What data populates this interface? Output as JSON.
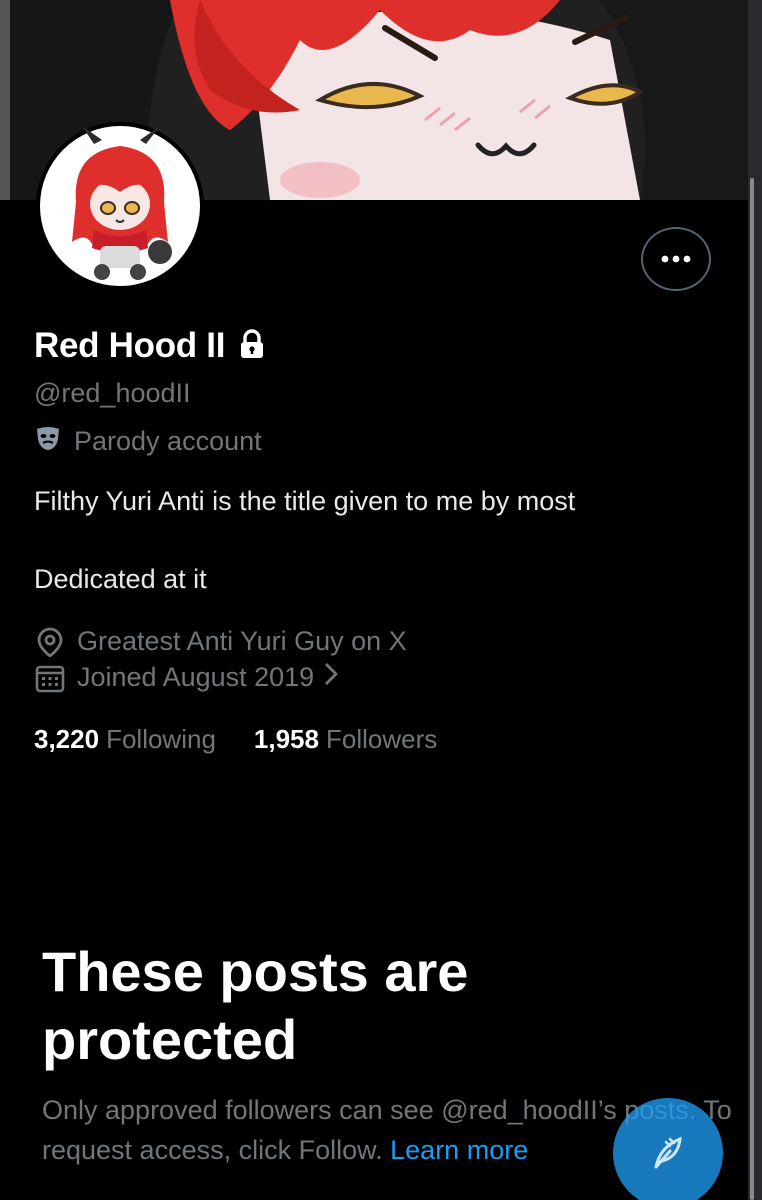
{
  "profile": {
    "display_name": "Red Hood II",
    "handle": "@red_hoodII",
    "label": "Parody account",
    "bio_line1": "Filthy Yuri Anti is the title given to me by most",
    "bio_line2": "Dedicated at it",
    "location": "Greatest Anti Yuri Guy on X",
    "joined": "Joined August 2019"
  },
  "stats": {
    "following_count": "3,220",
    "following_label": "Following",
    "followers_count": "1,958",
    "followers_label": "Followers"
  },
  "protected": {
    "title": "These posts are protected",
    "description": "Only approved followers can see @red_hoodII’s posts. To request access, click Follow.",
    "learn_more": "Learn more"
  },
  "colors": {
    "background": "#000000",
    "accent": "#1d9bf0",
    "muted_text": "#71767b",
    "avatar_hair": "#e0302a"
  },
  "icons": {
    "more": "more-icon",
    "lock": "lock-icon",
    "parody": "mask-icon",
    "location": "location-pin-icon",
    "calendar": "calendar-icon",
    "chevron": "chevron-right-icon",
    "compose": "compose-feather-icon"
  }
}
